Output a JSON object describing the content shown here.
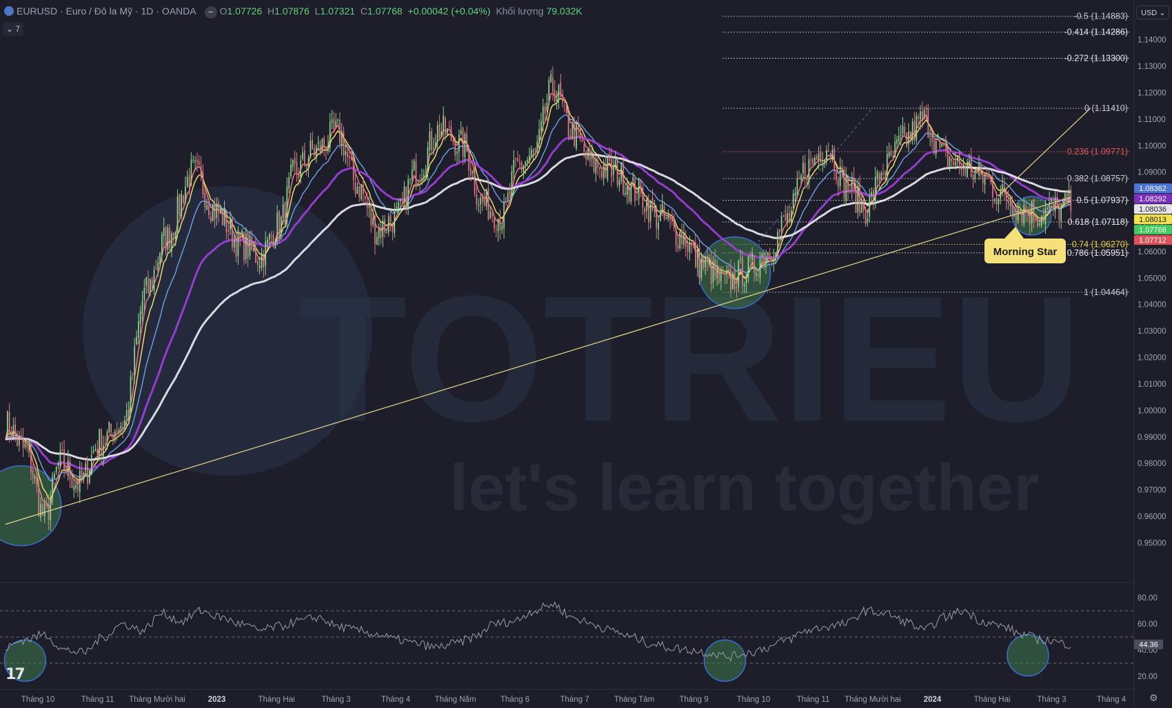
{
  "header": {
    "symbol": "EURUSD · Euro / Đô la Mỹ · 1D · OANDA",
    "minus": "−",
    "o_key": "O",
    "o_val": "1.07726",
    "h_key": "H",
    "h_val": "1.07876",
    "l_key": "L",
    "l_val": "1.07321",
    "c_key": "C",
    "c_val": "1.07768",
    "change": "+0.00042 (+0.04%)",
    "volume_label": "Khối lượng",
    "volume_value": "79.032K",
    "collapse_label": "⌄ 7",
    "currency": "USD ⌄"
  },
  "watermark": {
    "brand": "TOTRIEU",
    "tagline": "let's learn together"
  },
  "tv_logo": "17",
  "gear_icon": "⚙",
  "chart_data": [
    {
      "type": "line",
      "title": "EURUSD · Euro / Đô la Mỹ · 1D · OANDA",
      "xlabel": "",
      "ylabel": "",
      "ylim": [
        0.935,
        1.155
      ],
      "x_tick_labels": [
        "Tháng 10",
        "Tháng 11",
        "Tháng Mười hai",
        "2023",
        "Tháng Hai",
        "Tháng 3",
        "Tháng 4",
        "Tháng Năm",
        "Tháng 6",
        "Tháng 7",
        "Tháng Tám",
        "Tháng 9",
        "Tháng 10",
        "Tháng 11",
        "Tháng Mười hai",
        "2024",
        "Tháng Hai",
        "Tháng 3",
        "Tháng 4"
      ],
      "y_tick_labels": [
        "1.14000",
        "1.13000",
        "1.12000",
        "1.11000",
        "1.10000",
        "1.09000",
        "1.08000",
        "1.07000",
        "1.06000",
        "1.05000",
        "1.04000",
        "1.03000",
        "1.02000",
        "1.01000",
        "1.00000",
        "0.99000",
        "0.98000",
        "0.97000",
        "0.96000",
        "0.95000"
      ],
      "price_anchors": {
        "x": [
          0,
          10,
          20,
          28,
          38,
          48,
          60,
          72,
          82,
          96,
          108,
          120,
          130,
          140,
          148,
          158,
          170,
          180,
          190,
          200,
          210,
          222,
          234,
          244,
          254,
          262,
          270,
          280,
          290,
          300,
          312,
          322,
          334,
          346,
          356,
          368,
          380,
          390,
          400,
          410,
          420,
          430,
          440,
          450,
          460,
          470,
          480,
          490,
          500,
          510,
          520,
          528,
          536,
          545
        ],
        "y": [
          0.995,
          0.985,
          0.96,
          0.98,
          0.972,
          0.988,
          0.995,
          1.045,
          1.065,
          1.09,
          1.075,
          1.063,
          1.058,
          1.07,
          1.09,
          1.098,
          1.105,
          1.085,
          1.068,
          1.073,
          1.09,
          1.106,
          1.1,
          1.078,
          1.073,
          1.092,
          1.096,
          1.122,
          1.105,
          1.093,
          1.09,
          1.083,
          1.073,
          1.066,
          1.055,
          1.048,
          1.053,
          1.06,
          1.072,
          1.092,
          1.1,
          1.085,
          1.076,
          1.092,
          1.102,
          1.11,
          1.096,
          1.092,
          1.088,
          1.081,
          1.076,
          1.074,
          1.076,
          1.0777
        ]
      },
      "series": [
        {
          "name": "",
          "color": "#ff7a8a",
          "smooth": 5,
          "x_start": 0
        },
        {
          "name": "",
          "color": "#f5e86a",
          "smooth": 9,
          "x_start": 0
        },
        {
          "name": "",
          "color": "#6fa2e8",
          "smooth": 20,
          "x_start": 0
        },
        {
          "name": "",
          "color": "#9b3fd6",
          "smooth": 45,
          "x_start": 0
        },
        {
          "name": "",
          "color": "#e4e4ea",
          "smooth": 90,
          "x_start": 0
        }
      ],
      "fibonacci": [
        {
          "label": "-0.5 (1.14883)",
          "value": 1.14883,
          "color": "#c8c8d0"
        },
        {
          "label": "-0.414 (1.14286)",
          "value": 1.14286,
          "color": "#e8e8ee"
        },
        {
          "label": "-0.272 (1.13300)",
          "value": 1.133,
          "color": "#e8e8ee"
        },
        {
          "label": "0 (1.11410)",
          "value": 1.1141,
          "color": "#c8c8d0"
        },
        {
          "label": "0.236 (1.09771)",
          "value": 1.09771,
          "color": "#e05a5a"
        },
        {
          "label": "0.382 (1.08757)",
          "value": 1.08757,
          "color": "#c8c8d0"
        },
        {
          "label": "0.5 (1.07937)",
          "value": 1.07937,
          "color": "#e8e8ee"
        },
        {
          "label": "0.618 (1.07118)",
          "value": 1.07118,
          "color": "#e8e8ee"
        },
        {
          "label": "0.74 (1.06270)",
          "value": 1.0627,
          "color": "#e8d24a"
        },
        {
          "label": "0.786 (1.05951)",
          "value": 1.05951,
          "color": "#e8e8ee"
        },
        {
          "label": "1 (1.04464)",
          "value": 1.04464,
          "color": "#c8c8d0"
        }
      ],
      "price_badges": [
        {
          "label": "1.08362",
          "value": 1.08362,
          "color": "#4a74d6",
          "text": "#ffffff"
        },
        {
          "label": "1.08292",
          "value": 1.08292,
          "color": "#7b2fc0",
          "text": "#ffffff"
        },
        {
          "label": "1.08036",
          "value": 1.08036,
          "color": "#e4e4ea",
          "text": "#222222"
        },
        {
          "label": "1.08013",
          "value": 1.08013,
          "color": "#f2e14a",
          "text": "#222222"
        },
        {
          "label": "1.07768",
          "value": 1.07768,
          "color": "#44c862",
          "text": "#ffffff"
        },
        {
          "label": "1.07712",
          "value": 1.07712,
          "color": "#e0505a",
          "text": "#ffffff"
        }
      ],
      "trendline": {
        "from": [
          0,
          0.957
        ],
        "to": [
          545,
          1.0805
        ]
      },
      "fib_upline": {
        "from": [
          508,
          1.081
        ],
        "to": [
          555,
          1.1141
        ]
      },
      "annotation": "Morning Star",
      "highlight_circles": [
        {
          "x": 8,
          "y": 0.964
        },
        {
          "x": 373,
          "y": 1.052
        },
        {
          "x": 525,
          "y": 1.0735
        }
      ]
    },
    {
      "type": "line",
      "title": "",
      "xlabel": "",
      "ylabel": "",
      "ylim": [
        10,
        90
      ],
      "y_tick_labels": [
        "80.00",
        "60.00",
        "40.00",
        "20.00"
      ],
      "guide_levels": [
        70,
        50,
        30
      ],
      "current_value": "44.36",
      "rsi_anchors": {
        "x": [
          0,
          10,
          20,
          30,
          40,
          50,
          60,
          70,
          80,
          90,
          100,
          110,
          120,
          130,
          140,
          150,
          160,
          170,
          180,
          190,
          200,
          210,
          220,
          230,
          240,
          250,
          260,
          270,
          280,
          290,
          300,
          310,
          320,
          330,
          340,
          350,
          360,
          370,
          380,
          390,
          400,
          410,
          420,
          430,
          440,
          450,
          460,
          470,
          480,
          490,
          500,
          510,
          520,
          530,
          545
        ],
        "y": [
          42,
          48,
          52,
          40,
          38,
          50,
          60,
          55,
          68,
          62,
          70,
          65,
          60,
          55,
          58,
          62,
          65,
          58,
          55,
          52,
          48,
          45,
          42,
          45,
          50,
          60,
          62,
          70,
          75,
          65,
          60,
          55,
          50,
          45,
          42,
          40,
          38,
          35,
          38,
          42,
          48,
          55,
          58,
          60,
          70,
          68,
          62,
          55,
          65,
          70,
          62,
          58,
          52,
          48,
          44.36
        ]
      },
      "highlight_circles": [
        {
          "x": 10,
          "y": 32
        },
        {
          "x": 368,
          "y": 32
        },
        {
          "x": 523,
          "y": 36
        }
      ]
    }
  ]
}
